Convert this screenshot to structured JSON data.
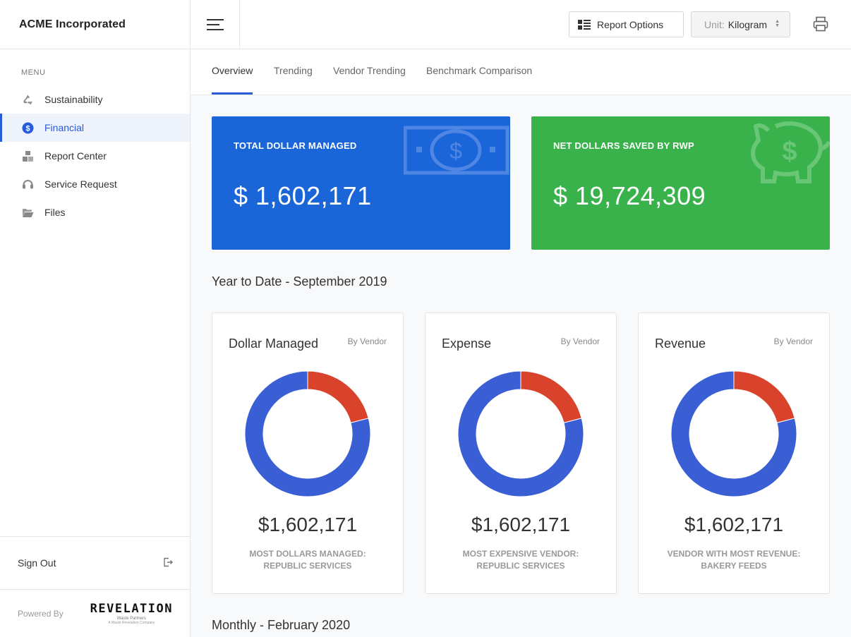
{
  "app": {
    "company": "ACME Incorporated"
  },
  "sidebar": {
    "menu_label": "MENU",
    "items": [
      {
        "label": "Sustainability",
        "icon": "recycle-icon"
      },
      {
        "label": "Financial",
        "icon": "dollar-circle-icon",
        "active": true
      },
      {
        "label": "Report Center",
        "icon": "boxes-icon"
      },
      {
        "label": "Service Request",
        "icon": "headset-icon"
      },
      {
        "label": "Files",
        "icon": "folder-open-icon"
      }
    ],
    "sign_out": "Sign Out",
    "powered_by": "Powered By",
    "logo": {
      "name": "REVELATION",
      "sub": "Waste Partners",
      "sub2": "A Waste Revelation Company"
    }
  },
  "topbar": {
    "report_options": "Report Options",
    "unit_label": "Unit:",
    "unit_value": "Kilogram"
  },
  "tabs": [
    {
      "label": "Overview",
      "active": true
    },
    {
      "label": "Trending"
    },
    {
      "label": "Vendor Trending"
    },
    {
      "label": "Benchmark Comparison"
    }
  ],
  "stats": {
    "total": {
      "title": "TOTAL DOLLAR MANAGED",
      "value": "$ 1,602,171",
      "color": "#1a66d9"
    },
    "saved": {
      "title": "NET DOLLARS SAVED BY RWP",
      "value": "$ 19,724,309",
      "color": "#3ab24c"
    }
  },
  "sections": {
    "ytd": "Year to Date - September 2019",
    "monthly": "Monthly - February 2020"
  },
  "cards": [
    {
      "title": "Dollar Managed",
      "by": "By Vendor",
      "value": "$1,602,171",
      "caption1": "MOST DOLLARS MANAGED:",
      "caption2": "REPUBLIC SERVICES"
    },
    {
      "title": "Expense",
      "by": "By Vendor",
      "value": "$1,602,171",
      "caption1": "MOST EXPENSIVE VENDOR:",
      "caption2": "REPUBLIC SERVICES"
    },
    {
      "title": "Revenue",
      "by": "By Vendor",
      "value": "$1,602,171",
      "caption1": "VENDOR WITH MOST REVENUE:",
      "caption2": "BAKERY FEEDS"
    }
  ],
  "chart_data": [
    {
      "type": "pie",
      "variant": "donut",
      "values": [
        0.21,
        0.79
      ],
      "colors": [
        "#d9432b",
        "#3a5fd5"
      ]
    },
    {
      "type": "pie",
      "variant": "donut",
      "values": [
        0.21,
        0.79
      ],
      "colors": [
        "#d9432b",
        "#3a5fd5"
      ]
    },
    {
      "type": "pie",
      "variant": "donut",
      "values": [
        0.21,
        0.79
      ],
      "colors": [
        "#d9432b",
        "#3a5fd5"
      ]
    }
  ]
}
